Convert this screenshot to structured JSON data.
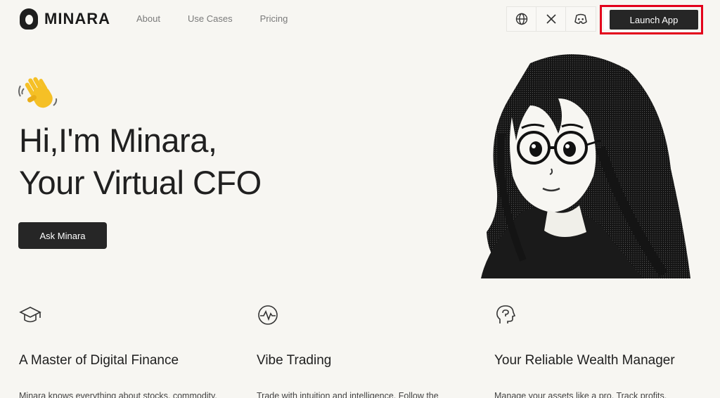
{
  "brand": {
    "name": "MINARA"
  },
  "nav": {
    "items": [
      {
        "label": "About"
      },
      {
        "label": "Use Cases"
      },
      {
        "label": "Pricing"
      }
    ]
  },
  "header_icons": [
    "globe-icon",
    "x-logo-icon",
    "discord-icon"
  ],
  "launch": {
    "label": "Launch App"
  },
  "hero": {
    "emoji": "👋",
    "title_line1": "Hi,I'm Minara,",
    "title_line2": "Your Virtual CFO",
    "cta_label": "Ask Minara"
  },
  "features": [
    {
      "icon": "graduation-cap-icon",
      "title": "A Master of Digital Finance",
      "text": "Minara knows everything about stocks, commodity,"
    },
    {
      "icon": "pulse-icon",
      "title": "Vibe Trading",
      "text": "Trade with intuition and intelligence. Follow the"
    },
    {
      "icon": "head-brain-icon",
      "title": "Your Reliable Wealth Manager",
      "text": "Manage your assets like a pro. Track profits,"
    }
  ],
  "colors": {
    "background": "#f7f6f2",
    "button": "#262626",
    "highlight": "#e3001b"
  }
}
